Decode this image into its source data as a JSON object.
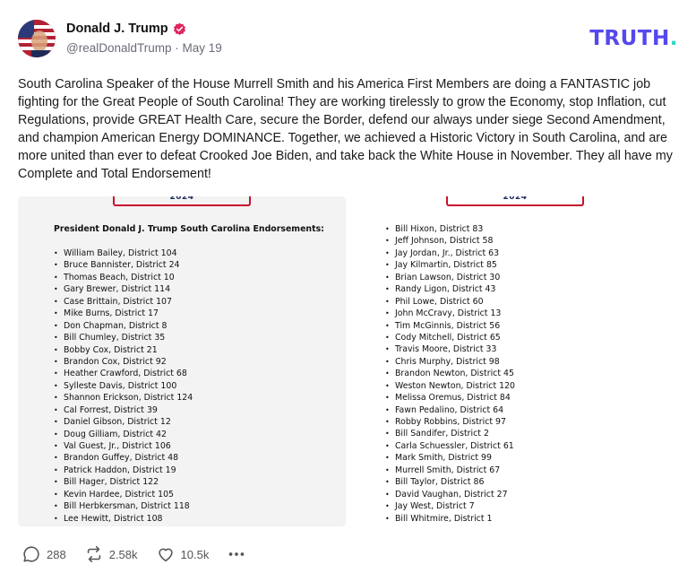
{
  "post": {
    "author": {
      "display_name": "Donald J. Trump",
      "handle": "@realDonaldTrump",
      "separator": "·",
      "date": "May 19"
    },
    "logo": {
      "text": "TRUTH",
      "dot": ".",
      "color": "#5448ee",
      "dot_color": "#2fd6c5"
    },
    "text": "South Carolina Speaker of the House Murrell Smith and his America First Members are doing a FANTASTIC job fighting for the Great People of South Carolina! They are working tirelessly to grow the Economy, stop Inflation, cut Regulations, provide GREAT Health Care, secure the Border, defend our always under siege Second Amendment, and champion American Energy DOMINANCE. Together, we achieved a Historic Victory in South Carolina, and are more united than ever to defeat Crooked Joe Biden, and take back the White House in November. They all have my Complete and Total Endorsement!"
  },
  "attachments": {
    "left": {
      "banner_year": "2024",
      "heading": "President Donald J. Trump South Carolina Endorsements:",
      "items": [
        "William Bailey, District 104",
        "Bruce Bannister, District 24",
        "Thomas Beach, District 10",
        "Gary Brewer, District 114",
        "Case Brittain, District 107",
        "Mike Burns, District 17",
        "Don Chapman, District 8",
        "Bill Chumley, District 35",
        "Bobby Cox, District 21",
        "Brandon Cox, District 92",
        "Heather Crawford, District 68",
        "Sylleste Davis, District 100",
        "Shannon Erickson, District 124",
        "Cal Forrest, District 39",
        "Daniel Gibson, District 12",
        "Doug Gilliam, District 42",
        "Val Guest, Jr., District 106",
        "Brandon Guffey, District 48",
        "Patrick Haddon, District 19",
        "Bill Hager, District 122",
        "Kevin Hardee, District 105",
        "Bill Herbkersman, District 118",
        "Lee Hewitt, District 108"
      ]
    },
    "right": {
      "banner_year": "2024",
      "items": [
        "Bill Hixon, District 83",
        "Jeff Johnson, District 58",
        "Jay Jordan, Jr., District 63",
        "Jay Kilmartin, District 85",
        "Brian Lawson, District 30",
        "Randy Ligon, District 43",
        "Phil Lowe, District 60",
        "John McCravy, District 13",
        "Tim McGinnis, District 56",
        "Cody Mitchell, District 65",
        "Travis Moore, District 33",
        "Chris Murphy, District 98",
        "Brandon Newton, District 45",
        "Weston Newton, District 120",
        "Melissa Oremus, District 84",
        "Fawn Pedalino, District 64",
        "Robby Robbins, District 97",
        "Bill Sandifer, District 2",
        "Carla Schuessler, District 61",
        "Mark Smith, District 99",
        "Murrell Smith, District 67",
        "Bill Taylor, District 86",
        "David Vaughan, District 27",
        "Jay West, District 7",
        "Bill Whitmire, District 1"
      ]
    }
  },
  "actions": {
    "replies": "288",
    "retruths": "2.58k",
    "likes": "10.5k"
  },
  "icons": {
    "verified": "verified-badge-icon",
    "reply": "reply-bubble-icon",
    "retruth": "retruth-arrows-icon",
    "like": "heart-icon",
    "more": "more-dots-icon"
  },
  "colors": {
    "verified": "#e0245e",
    "banner_red": "#c8102e",
    "banner_navy": "#1c2a5c"
  }
}
